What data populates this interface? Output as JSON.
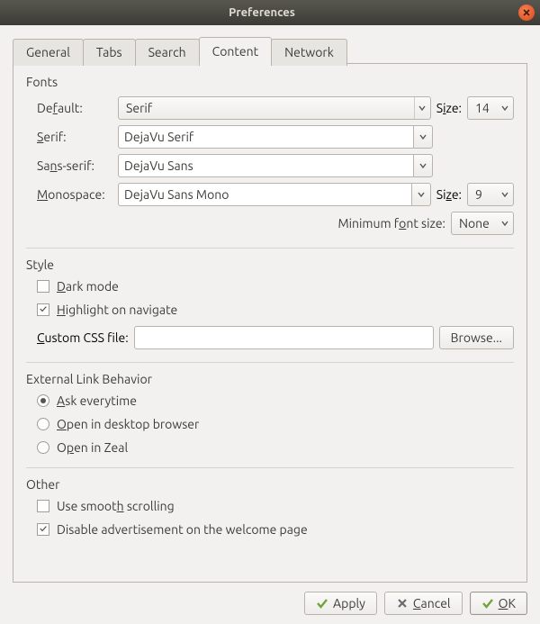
{
  "window": {
    "title": "Preferences"
  },
  "tabs": [
    "General",
    "Tabs",
    "Search",
    "Content",
    "Network"
  ],
  "active_tab": 3,
  "fonts": {
    "section": "Fonts",
    "default_label": "Default:",
    "default_value": "Serif",
    "default_size_label": "Size:",
    "default_size": "14",
    "serif_label": "Serif:",
    "serif_value": "DejaVu Serif",
    "sans_label": "Sans-serif:",
    "sans_value": "DejaVu Sans",
    "mono_label": "Monospace:",
    "mono_value": "DejaVu Sans Mono",
    "mono_size_label": "Size:",
    "mono_size": "9",
    "min_size_label": "Minimum font size:",
    "min_size_value": "None"
  },
  "style": {
    "section": "Style",
    "dark_mode_label": "Dark mode",
    "dark_mode_checked": false,
    "highlight_label": "Highlight on navigate",
    "highlight_checked": true,
    "custom_css_label": "Custom CSS file:",
    "custom_css_value": "",
    "browse_label": "Browse..."
  },
  "external": {
    "section": "External Link Behavior",
    "ask_label": "Ask everytime",
    "desktop_label": "Open in desktop browser",
    "zeal_label": "Open in Zeal",
    "selected": "ask"
  },
  "other": {
    "section": "Other",
    "smooth_label": "Use smooth scrolling",
    "smooth_checked": false,
    "disable_ads_label": "Disable advertisement on the welcome page",
    "disable_ads_checked": true
  },
  "buttons": {
    "apply": "Apply",
    "cancel": "Cancel",
    "ok": "OK"
  }
}
